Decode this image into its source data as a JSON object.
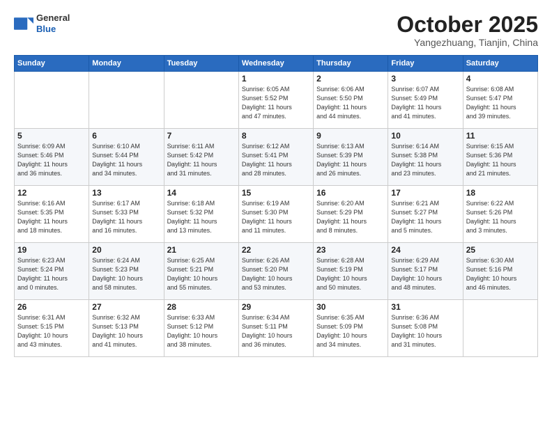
{
  "header": {
    "logo_general": "General",
    "logo_blue": "Blue",
    "month_title": "October 2025",
    "location": "Yangezhuang, Tianjin, China"
  },
  "days_of_week": [
    "Sunday",
    "Monday",
    "Tuesday",
    "Wednesday",
    "Thursday",
    "Friday",
    "Saturday"
  ],
  "weeks": [
    [
      {
        "day": "",
        "info": ""
      },
      {
        "day": "",
        "info": ""
      },
      {
        "day": "",
        "info": ""
      },
      {
        "day": "1",
        "info": "Sunrise: 6:05 AM\nSunset: 5:52 PM\nDaylight: 11 hours\nand 47 minutes."
      },
      {
        "day": "2",
        "info": "Sunrise: 6:06 AM\nSunset: 5:50 PM\nDaylight: 11 hours\nand 44 minutes."
      },
      {
        "day": "3",
        "info": "Sunrise: 6:07 AM\nSunset: 5:49 PM\nDaylight: 11 hours\nand 41 minutes."
      },
      {
        "day": "4",
        "info": "Sunrise: 6:08 AM\nSunset: 5:47 PM\nDaylight: 11 hours\nand 39 minutes."
      }
    ],
    [
      {
        "day": "5",
        "info": "Sunrise: 6:09 AM\nSunset: 5:46 PM\nDaylight: 11 hours\nand 36 minutes."
      },
      {
        "day": "6",
        "info": "Sunrise: 6:10 AM\nSunset: 5:44 PM\nDaylight: 11 hours\nand 34 minutes."
      },
      {
        "day": "7",
        "info": "Sunrise: 6:11 AM\nSunset: 5:42 PM\nDaylight: 11 hours\nand 31 minutes."
      },
      {
        "day": "8",
        "info": "Sunrise: 6:12 AM\nSunset: 5:41 PM\nDaylight: 11 hours\nand 28 minutes."
      },
      {
        "day": "9",
        "info": "Sunrise: 6:13 AM\nSunset: 5:39 PM\nDaylight: 11 hours\nand 26 minutes."
      },
      {
        "day": "10",
        "info": "Sunrise: 6:14 AM\nSunset: 5:38 PM\nDaylight: 11 hours\nand 23 minutes."
      },
      {
        "day": "11",
        "info": "Sunrise: 6:15 AM\nSunset: 5:36 PM\nDaylight: 11 hours\nand 21 minutes."
      }
    ],
    [
      {
        "day": "12",
        "info": "Sunrise: 6:16 AM\nSunset: 5:35 PM\nDaylight: 11 hours\nand 18 minutes."
      },
      {
        "day": "13",
        "info": "Sunrise: 6:17 AM\nSunset: 5:33 PM\nDaylight: 11 hours\nand 16 minutes."
      },
      {
        "day": "14",
        "info": "Sunrise: 6:18 AM\nSunset: 5:32 PM\nDaylight: 11 hours\nand 13 minutes."
      },
      {
        "day": "15",
        "info": "Sunrise: 6:19 AM\nSunset: 5:30 PM\nDaylight: 11 hours\nand 11 minutes."
      },
      {
        "day": "16",
        "info": "Sunrise: 6:20 AM\nSunset: 5:29 PM\nDaylight: 11 hours\nand 8 minutes."
      },
      {
        "day": "17",
        "info": "Sunrise: 6:21 AM\nSunset: 5:27 PM\nDaylight: 11 hours\nand 5 minutes."
      },
      {
        "day": "18",
        "info": "Sunrise: 6:22 AM\nSunset: 5:26 PM\nDaylight: 11 hours\nand 3 minutes."
      }
    ],
    [
      {
        "day": "19",
        "info": "Sunrise: 6:23 AM\nSunset: 5:24 PM\nDaylight: 11 hours\nand 0 minutes."
      },
      {
        "day": "20",
        "info": "Sunrise: 6:24 AM\nSunset: 5:23 PM\nDaylight: 10 hours\nand 58 minutes."
      },
      {
        "day": "21",
        "info": "Sunrise: 6:25 AM\nSunset: 5:21 PM\nDaylight: 10 hours\nand 55 minutes."
      },
      {
        "day": "22",
        "info": "Sunrise: 6:26 AM\nSunset: 5:20 PM\nDaylight: 10 hours\nand 53 minutes."
      },
      {
        "day": "23",
        "info": "Sunrise: 6:28 AM\nSunset: 5:19 PM\nDaylight: 10 hours\nand 50 minutes."
      },
      {
        "day": "24",
        "info": "Sunrise: 6:29 AM\nSunset: 5:17 PM\nDaylight: 10 hours\nand 48 minutes."
      },
      {
        "day": "25",
        "info": "Sunrise: 6:30 AM\nSunset: 5:16 PM\nDaylight: 10 hours\nand 46 minutes."
      }
    ],
    [
      {
        "day": "26",
        "info": "Sunrise: 6:31 AM\nSunset: 5:15 PM\nDaylight: 10 hours\nand 43 minutes."
      },
      {
        "day": "27",
        "info": "Sunrise: 6:32 AM\nSunset: 5:13 PM\nDaylight: 10 hours\nand 41 minutes."
      },
      {
        "day": "28",
        "info": "Sunrise: 6:33 AM\nSunset: 5:12 PM\nDaylight: 10 hours\nand 38 minutes."
      },
      {
        "day": "29",
        "info": "Sunrise: 6:34 AM\nSunset: 5:11 PM\nDaylight: 10 hours\nand 36 minutes."
      },
      {
        "day": "30",
        "info": "Sunrise: 6:35 AM\nSunset: 5:09 PM\nDaylight: 10 hours\nand 34 minutes."
      },
      {
        "day": "31",
        "info": "Sunrise: 6:36 AM\nSunset: 5:08 PM\nDaylight: 10 hours\nand 31 minutes."
      },
      {
        "day": "",
        "info": ""
      }
    ]
  ]
}
